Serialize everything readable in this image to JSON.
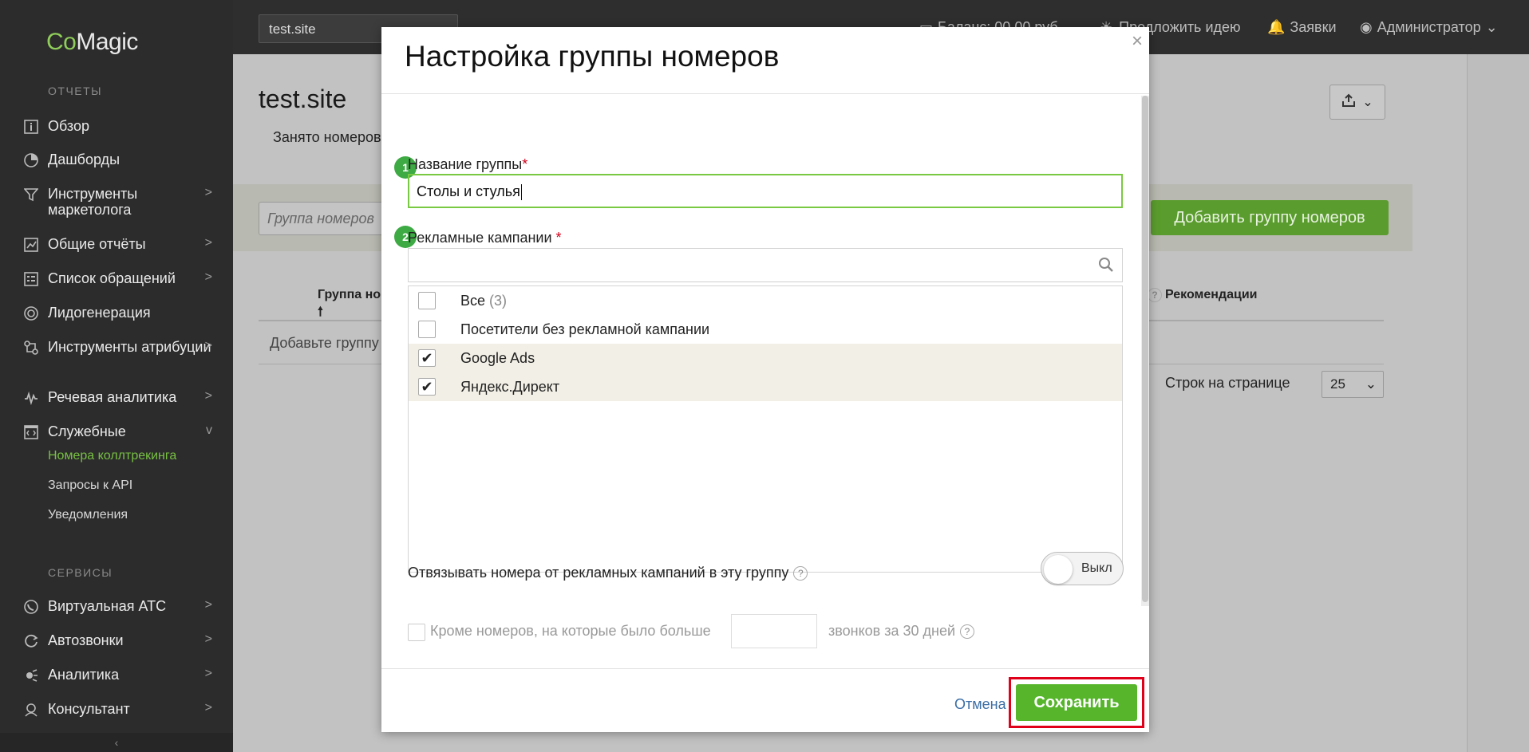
{
  "sidebar": {
    "logo_co": "Co",
    "logo_rest": "Magic",
    "section_reports": "ОТЧЕТЫ",
    "section_services": "СЕРВИСЫ",
    "items": [
      {
        "label": "Обзор",
        "icon": "info-icon"
      },
      {
        "label": "Дашборды",
        "icon": "pie-icon"
      },
      {
        "label": "Инструменты маркетолога",
        "icon": "funnel-icon"
      },
      {
        "label": "Общие отчёты",
        "icon": "chart-icon"
      },
      {
        "label": "Список обращений",
        "icon": "list-icon"
      },
      {
        "label": "Лидогенерация",
        "icon": "target-icon"
      },
      {
        "label": "Инструменты атрибуции",
        "icon": "attribution-icon"
      },
      {
        "label": "Речевая аналитика",
        "icon": "wave-icon"
      },
      {
        "label": "Служебные",
        "icon": "code-icon"
      }
    ],
    "sub_items": [
      "Номера коллтрекинга",
      "Запросы к API",
      "Уведомления"
    ],
    "service_items": [
      {
        "label": "Виртуальная АТС",
        "icon": "phone-icon"
      },
      {
        "label": "Автозвонки",
        "icon": "autocall-icon"
      },
      {
        "label": "Аналитика",
        "icon": "analytics-icon"
      },
      {
        "label": "Консультант",
        "icon": "consultant-icon"
      }
    ],
    "arrow": ">",
    "arrow_open": "v",
    "collapse": "‹"
  },
  "topbar": {
    "site": "test.site",
    "balance": "Баланс: 00.00 руб.",
    "suggest": "Предложить идею",
    "requests": "Заявки",
    "user": "Администратор"
  },
  "main": {
    "title": "test.site",
    "busy_tab": "Занято номеров",
    "filter_placeholder": "Группа номеров",
    "add_group": "Добавить группу номеров",
    "col_group": "Группа но",
    "col_recommend": "Рекомендации",
    "empty": "Добавьте группу",
    "rows_label": "Строк на странице",
    "rows_value": "25"
  },
  "modal": {
    "title": "Настройка группы номеров",
    "close": "×",
    "step1": "1",
    "step2": "2",
    "name_label": "Название группы",
    "name_value": "Столы и стулья",
    "campaigns_label": "Рекламные кампании ",
    "required": "*",
    "campaigns": [
      {
        "label": "Все",
        "count": "(3)",
        "checked": false
      },
      {
        "label": "Посетители без рекламной кампании",
        "count": "",
        "checked": false
      },
      {
        "label": "Google Ads",
        "count": "",
        "checked": true
      },
      {
        "label": "Яндекс.Директ",
        "count": "",
        "checked": true
      }
    ],
    "unbind_label": "Отвязывать номера от рекламных кампаний в эту группу",
    "toggle_label": "Выкл",
    "except_label": "Кроме номеров, на которые было больше",
    "except_tail": "звонков за 30 дней",
    "help": "?",
    "cancel": "Отмена",
    "save": "Сохранить"
  },
  "colors": {
    "accent_green": "#56b52b",
    "highlight_red": "#e0001a",
    "sidebar_bg": "#2c2c2c"
  }
}
